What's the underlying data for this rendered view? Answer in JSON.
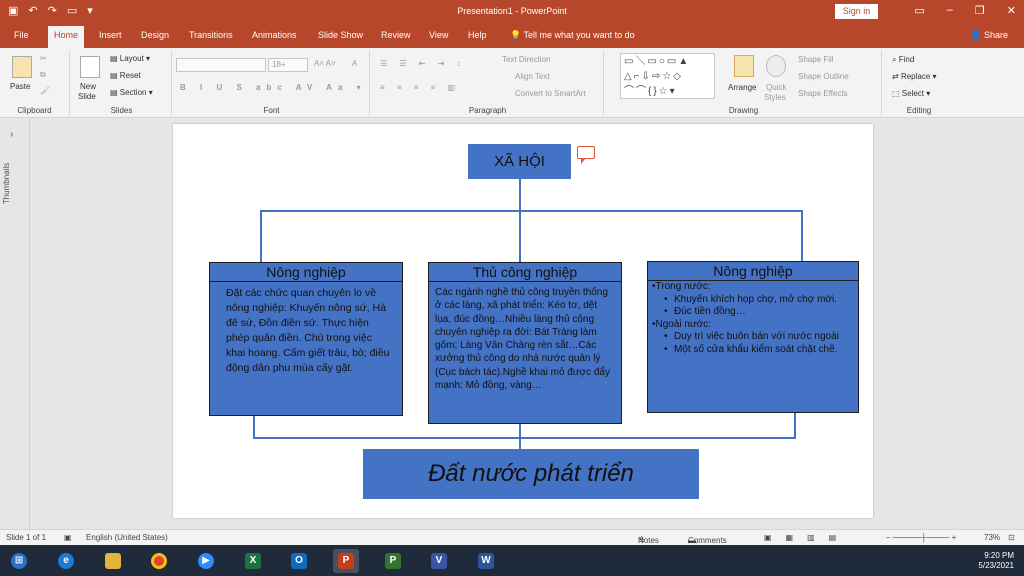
{
  "titlebar": {
    "title": "Presentation1 - PowerPoint",
    "signin": "Sign in"
  },
  "tabs": [
    "File",
    "Home",
    "Insert",
    "Design",
    "Transitions",
    "Animations",
    "Slide Show",
    "Review",
    "View",
    "Help"
  ],
  "active_tab": "Home",
  "tellme": "Tell me what you want to do",
  "share": "Share",
  "ribbon": {
    "clipboard": {
      "paste": "Paste",
      "label": "Clipboard"
    },
    "slides": {
      "new_slide_1": "New",
      "new_slide_2": "Slide",
      "layout": "Layout",
      "reset": "Reset",
      "section": "Section",
      "label": "Slides"
    },
    "font": {
      "size": "18+",
      "label": "Font"
    },
    "paragraph": {
      "text_direction": "Text Direction",
      "align_text": "Align Text",
      "smartart": "Convert to SmartArt",
      "label": "Paragraph"
    },
    "drawing": {
      "arrange": "Arrange",
      "quick_styles_1": "Quick",
      "quick_styles_2": "Styles",
      "shape_fill": "Shape Fill",
      "shape_outline": "Shape Outline",
      "shape_effects": "Shape Effects",
      "label": "Drawing"
    },
    "editing": {
      "find": "Find",
      "replace": "Replace",
      "select": "Select",
      "label": "Editing"
    }
  },
  "thumbnails_label": "Thumbnails",
  "slide": {
    "top": "XÃ HỘI",
    "left": {
      "title": "Nông nghiệp",
      "body": "Đặt các chức quan chuyên lo về nông nghiệp: Khuyến nông sứ, Hà đê sứ, Đồn điền sứ. Thực hiện phép quân điền. Chú trong việc khai hoang. Cấm giết trâu, bò; điều động dân phu mùa cấy gặt."
    },
    "middle": {
      "title": "Thủ công nghiệp",
      "body": "Các ngành nghề thủ công truyền thống ở các làng, xã phát triển: Kéo tơ, dệt lụa, đúc đồng…Nhiều làng thủ công chuyên nghiệp ra đời: Bát Tràng làm gốm; Làng Vân Chàng rèn sắt…Các xưởng thủ công do nhà nước quản lý (Cục bách tác).Nghề khai mỏ được đẩy mạnh: Mỏ đồng, vàng…"
    },
    "right": {
      "title": "Nông nghiệp",
      "l1a": "•Trong nước:",
      "b1": "Khuyến khích họp chợ, mở chợ mới.",
      "b2": "Đúc tiền đồng…",
      "l1b": "•Ngoài nước:",
      "b3": "Duy trì việc buôn bán với nước ngoài",
      "b4": "Một số cửa khẩu kiểm soát chặt chẽ."
    },
    "bottom": "Đất nước phát triển"
  },
  "status": {
    "slide": "Slide 1 of 1",
    "language": "English (United States)",
    "notes": "Notes",
    "comments": "Comments",
    "zoom": "73%"
  },
  "tray": {
    "time": "9:20 PM",
    "date": "5/23/2021"
  },
  "colors": {
    "accent": "#b7472a",
    "shape_fill": "#4472c4"
  }
}
